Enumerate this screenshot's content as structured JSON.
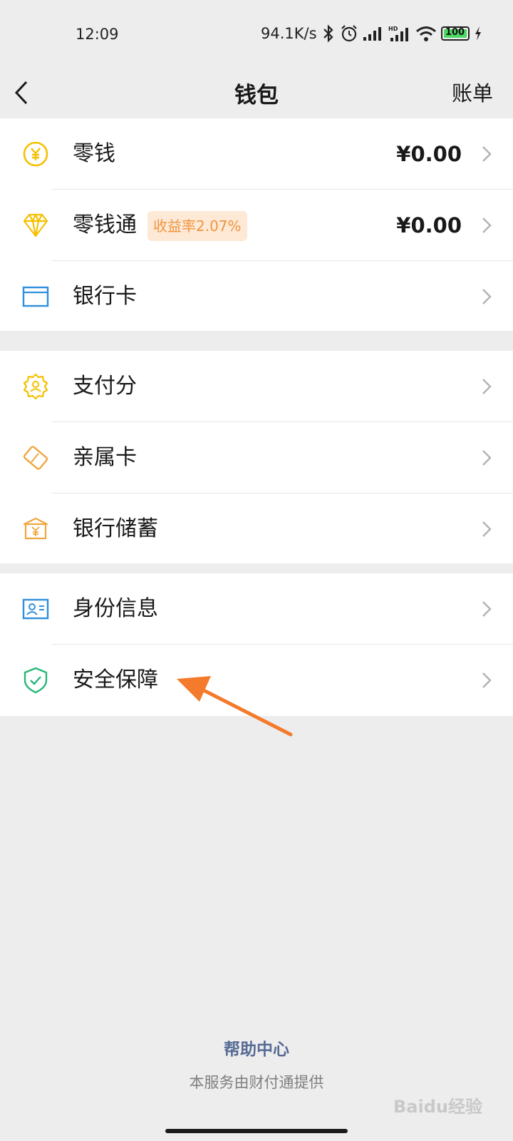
{
  "status_bar": {
    "time": "12:09",
    "net_speed": "94.1K/s",
    "battery": "100"
  },
  "nav": {
    "title": "钱包",
    "bill": "账单"
  },
  "group1": [
    {
      "label": "零钱",
      "value": "¥0.00",
      "icon": "yuan-coin-icon"
    },
    {
      "label": "零钱通",
      "badge": "收益率2.07%",
      "value": "¥0.00",
      "icon": "diamond-icon"
    },
    {
      "label": "银行卡",
      "icon": "bank-card-icon"
    }
  ],
  "group2": [
    {
      "label": "支付分",
      "icon": "badge-score-icon"
    },
    {
      "label": "亲属卡",
      "icon": "family-card-icon"
    },
    {
      "label": "银行储蓄",
      "icon": "bank-savings-icon"
    }
  ],
  "group3": [
    {
      "label": "身份信息",
      "icon": "id-card-icon"
    },
    {
      "label": "安全保障",
      "icon": "shield-icon"
    }
  ],
  "footer": {
    "help": "帮助中心",
    "note": "本服务由财付通提供"
  },
  "watermark": "Baidu经验",
  "colors": {
    "yellow": "#f5c000",
    "orange_icon": "#f0a63e",
    "blue_icon": "#2f8fdc",
    "green_icon": "#26b779",
    "arrow": "#f47a2c",
    "link": "#576b95"
  }
}
